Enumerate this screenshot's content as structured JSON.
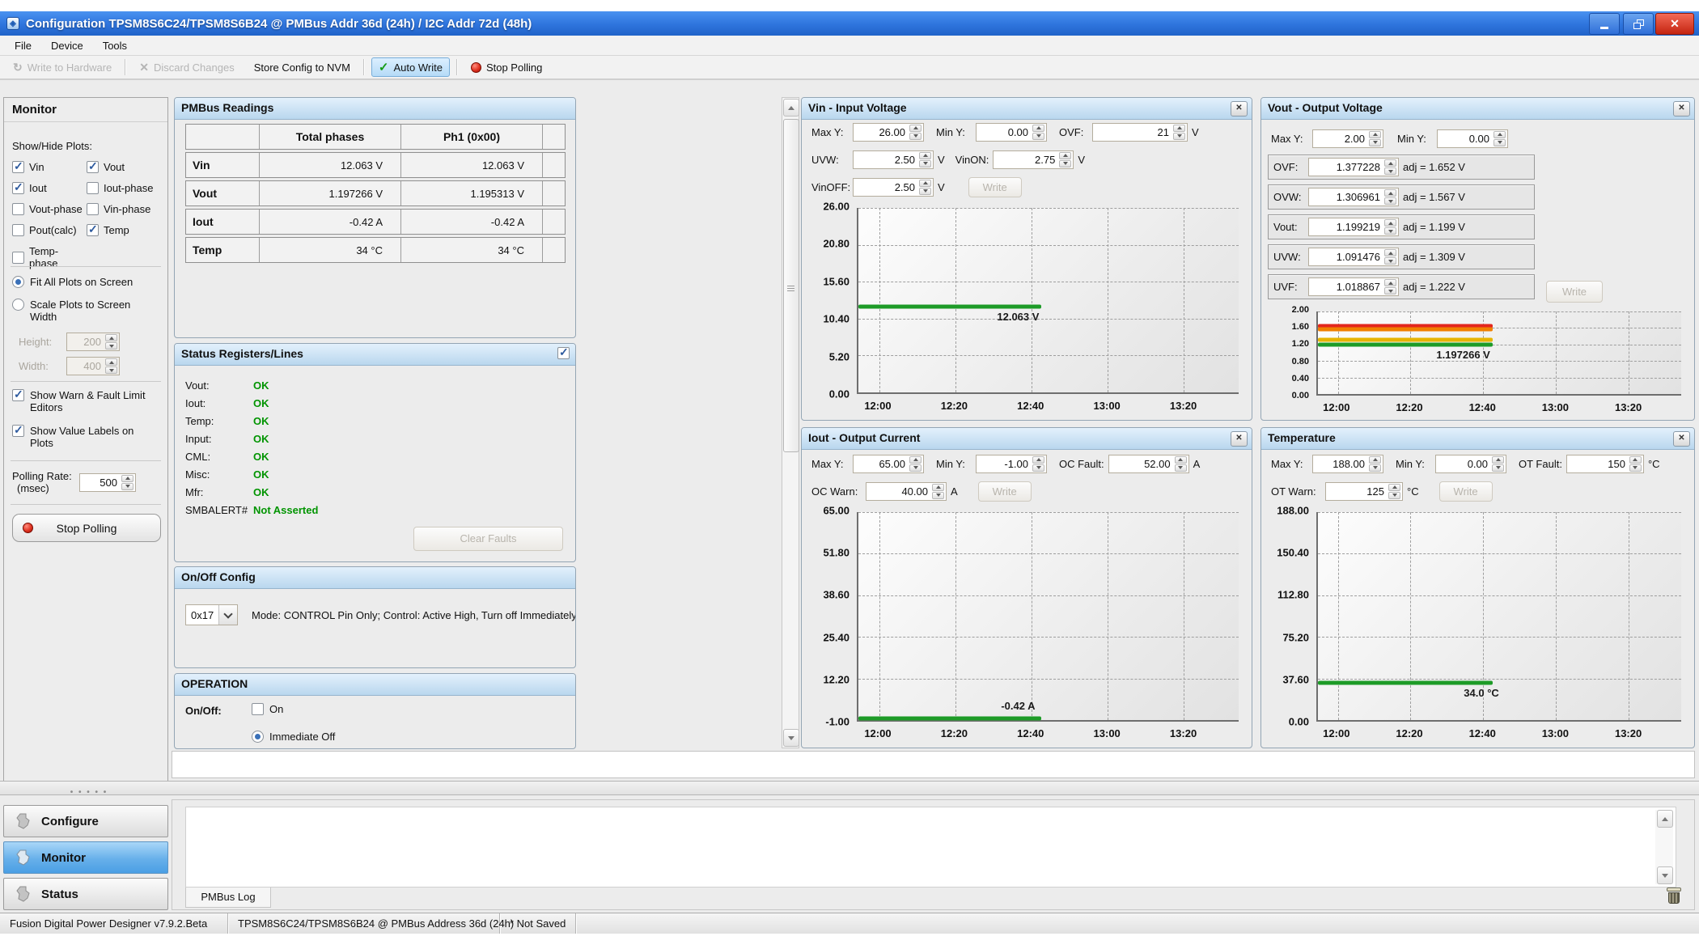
{
  "colors": {
    "titlebar_blue": "#2e74dd",
    "panel_header_blue": "#b9d7ee",
    "ok_green": "#009400",
    "plot_green": "#1d9b27",
    "limit_red": "#e3261d",
    "limit_orange": "#f07f00",
    "limit_yellow": "#e6b400",
    "selected_nav_blue": "#67b0ea"
  },
  "window": {
    "title": "Configuration TPSM8S6C24/TPSM8S6B24 @ PMBus Addr 36d (24h) / I2C Addr 72d (48h)",
    "menu": {
      "file": "File",
      "device": "Device",
      "tools": "Tools"
    },
    "toolbar": {
      "write_to_hardware": "Write to Hardware",
      "discard_changes": "Discard Changes",
      "store_config": "Store Config to NVM",
      "auto_write": "Auto Write",
      "stop_polling": "Stop Polling"
    }
  },
  "sidebar": {
    "title": "Monitor",
    "show_hide_label": "Show/Hide Plots:",
    "plot_toggles": [
      {
        "label": "Vin",
        "checked": true
      },
      {
        "label": "Vout",
        "checked": true
      },
      {
        "label": "Iout",
        "checked": true
      },
      {
        "label": "Iout-phase",
        "checked": false
      },
      {
        "label": "Vout-phase",
        "checked": false
      },
      {
        "label": "Vin-phase",
        "checked": false
      },
      {
        "label": "Pout(calc)",
        "checked": false
      },
      {
        "label": "Temp",
        "checked": true
      },
      {
        "label": "Temp-phase",
        "checked": false
      }
    ],
    "fit_all_label": "Fit All Plots on Screen",
    "scale_width_label": "Scale Plots to Screen Width",
    "height_label": "Height:",
    "height_value": "200",
    "width_label": "Width:",
    "width_value": "400",
    "show_warn_label": "Show Warn & Fault Limit Editors",
    "show_value_labels_label": "Show Value Labels on Plots",
    "polling_rate_label": "Polling Rate:",
    "polling_rate_unit": "(msec)",
    "polling_rate_value": "500",
    "stop_polling_label": "Stop Polling"
  },
  "nav": {
    "configure": "Configure",
    "monitor": "Monitor",
    "status": "Status"
  },
  "pmbus_readings": {
    "title": "PMBus Readings",
    "columns": [
      "",
      "Total phases",
      "Ph1 (0x00)"
    ],
    "rows": [
      {
        "name": "Vin",
        "total": "12.063 V",
        "ph1": "12.063 V"
      },
      {
        "name": "Vout",
        "total": "1.197266 V",
        "ph1": "1.195313 V"
      },
      {
        "name": "Iout",
        "total": "-0.42 A",
        "ph1": "-0.42 A"
      },
      {
        "name": "Temp",
        "total": "34 °C",
        "ph1": "34 °C"
      }
    ]
  },
  "status_registers": {
    "title": "Status Registers/Lines",
    "lines": [
      {
        "label": "Vout:",
        "value": "OK"
      },
      {
        "label": "Iout:",
        "value": "OK"
      },
      {
        "label": "Temp:",
        "value": "OK"
      },
      {
        "label": "Input:",
        "value": "OK"
      },
      {
        "label": "CML:",
        "value": "OK"
      },
      {
        "label": "Misc:",
        "value": "OK"
      },
      {
        "label": "Mfr:",
        "value": "OK"
      },
      {
        "label": "SMBALERT#",
        "value": "Not Asserted"
      }
    ],
    "clear_faults_label": "Clear Faults"
  },
  "on_off_config": {
    "title": "On/Off Config",
    "mode_value": "0x17",
    "description": "Mode: CONTROL Pin Only; Control: Active High, Turn off Immediately"
  },
  "operation": {
    "title": "OPERATION",
    "on_off_label": "On/Off:",
    "on_label": "On",
    "immediate_off_label": "Immediate Off"
  },
  "plots": {
    "vin": {
      "title": "Vin - Input Voltage",
      "max_y_label": "Max Y:",
      "max_y": "26.00",
      "min_y_label": "Min Y:",
      "min_y": "0.00",
      "ovf_label": "OVF:",
      "ovf": "21",
      "ovf_unit": "V",
      "uvw_label": "UVW:",
      "uvw": "2.50",
      "uvw_unit": "V",
      "vinon_label": "VinON:",
      "vinon": "2.75",
      "vinon_unit": "V",
      "vinoff_label": "VinOFF:",
      "vinoff": "2.50",
      "vinoff_unit": "V",
      "write_label": "Write",
      "chart": {
        "type": "line",
        "y_min": 0,
        "y_max": 26,
        "y_ticks": [
          "26.00",
          "20.80",
          "15.60",
          "10.40",
          "5.20",
          "0.00"
        ],
        "x_ticks": [
          "12:00",
          "12:20",
          "12:40",
          "13:00",
          "13:20"
        ],
        "series": [
          {
            "name": "Vin",
            "color": "#1d9b27",
            "value": 12.063,
            "x_start": 0,
            "x_end": 0.48,
            "label": "12.063 V",
            "label_x": 0.42,
            "label_side": "below"
          }
        ]
      }
    },
    "vout": {
      "title": "Vout - Output Voltage",
      "max_y_label": "Max Y:",
      "max_y": "2.00",
      "min_y_label": "Min Y:",
      "min_y": "0.00",
      "limit_rows": [
        {
          "label": "OVF:",
          "value": "1.377228",
          "adj": "adj = 1.652 V"
        },
        {
          "label": "OVW:",
          "value": "1.306961",
          "adj": "adj = 1.567 V"
        },
        {
          "label": "Vout:",
          "value": "1.199219",
          "adj": "adj = 1.199 V"
        },
        {
          "label": "UVW:",
          "value": "1.091476",
          "adj": "adj = 1.309 V"
        },
        {
          "label": "UVF:",
          "value": "1.018867",
          "adj": "adj = 1.222 V"
        }
      ],
      "write_label": "Write",
      "chart": {
        "type": "line",
        "y_min": 0,
        "y_max": 2,
        "y_ticks": [
          "2.00",
          "1.60",
          "1.20",
          "0.80",
          "0.40",
          "0.00"
        ],
        "x_ticks": [
          "12:00",
          "12:20",
          "12:40",
          "13:00",
          "13:20"
        ],
        "series": [
          {
            "name": "OVF limit",
            "color": "#e3261d",
            "value": 1.652,
            "x_start": 0,
            "x_end": 0.48
          },
          {
            "name": "OVW limit",
            "color": "#f07f00",
            "value": 1.567,
            "x_start": 0,
            "x_end": 0.48
          },
          {
            "name": "UVW limit",
            "color": "#e6b400",
            "value": 1.309,
            "x_start": 0,
            "x_end": 0.48
          },
          {
            "name": "Vout",
            "color": "#1d9b27",
            "value": 1.197266,
            "x_start": 0,
            "x_end": 0.48,
            "label": "1.197266 V",
            "label_x": 0.4,
            "label_side": "below"
          }
        ]
      }
    },
    "iout": {
      "title": "Iout - Output Current",
      "max_y_label": "Max Y:",
      "max_y": "65.00",
      "min_y_label": "Min Y:",
      "min_y": "-1.00",
      "oc_fault_label": "OC Fault:",
      "oc_fault": "52.00",
      "oc_fault_unit": "A",
      "oc_warn_label": "OC Warn:",
      "oc_warn": "40.00",
      "oc_warn_unit": "A",
      "write_label": "Write",
      "chart": {
        "type": "line",
        "y_min": -1,
        "y_max": 65,
        "y_ticks": [
          "65.00",
          "51.80",
          "38.60",
          "25.40",
          "12.20",
          "-1.00"
        ],
        "x_ticks": [
          "12:00",
          "12:20",
          "12:40",
          "13:00",
          "13:20"
        ],
        "series": [
          {
            "name": "Iout",
            "color": "#1d9b27",
            "value": -0.42,
            "x_start": 0,
            "x_end": 0.48,
            "label": "-0.42 A",
            "label_x": 0.42,
            "label_side": "above"
          }
        ]
      }
    },
    "temp": {
      "title": "Temperature",
      "max_y_label": "Max Y:",
      "max_y": "188.00",
      "min_y_label": "Min Y:",
      "min_y": "0.00",
      "ot_fault_label": "OT Fault:",
      "ot_fault": "150",
      "ot_fault_unit": "°C",
      "ot_warn_label": "OT Warn:",
      "ot_warn": "125",
      "ot_warn_unit": "°C",
      "write_label": "Write",
      "chart": {
        "type": "line",
        "y_min": 0,
        "y_max": 188,
        "y_ticks": [
          "188.00",
          "150.40",
          "112.80",
          "75.20",
          "37.60",
          "0.00"
        ],
        "x_ticks": [
          "12:00",
          "12:20",
          "12:40",
          "13:00",
          "13:20"
        ],
        "series": [
          {
            "name": "Temp",
            "color": "#1d9b27",
            "value": 34.0,
            "x_start": 0,
            "x_end": 0.48,
            "label": "34.0 °C",
            "label_x": 0.45,
            "label_side": "below"
          }
        ]
      }
    }
  },
  "log": {
    "tab_label": "PMBus Log"
  },
  "statusbar": {
    "app_version": "Fusion Digital Power Designer v7.9.2.Beta",
    "device": "TPSM8S6C24/TPSM8S6B24 @ PMBus Address 36d (24h)",
    "save_state": "* Not Saved"
  }
}
